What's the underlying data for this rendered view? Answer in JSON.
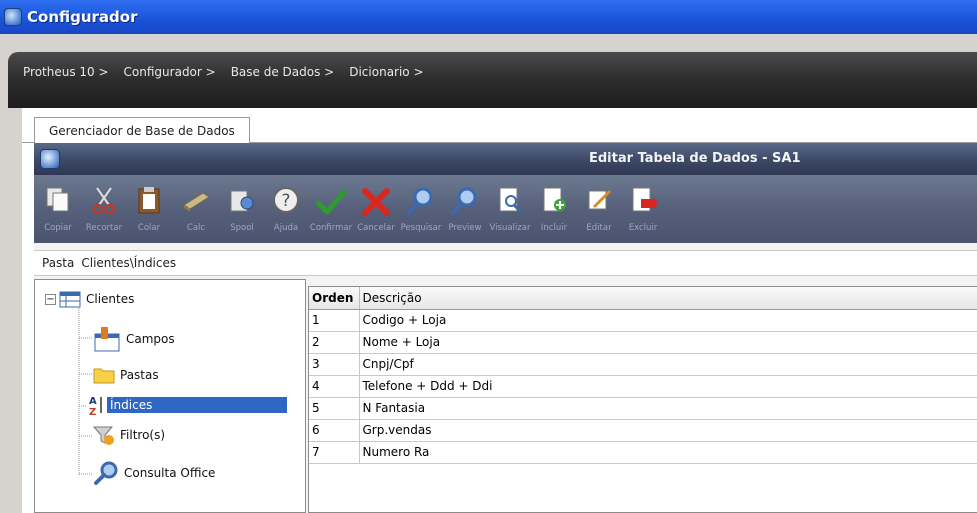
{
  "window": {
    "title": "Configurador"
  },
  "breadcrumb": [
    "Protheus 10 >",
    "Configurador >",
    "Base de Dados >",
    "Dicionario >"
  ],
  "tab": {
    "label": "Gerenciador de Base de Dados"
  },
  "editor": {
    "title": "Editar Tabela de Dados - SA1"
  },
  "toolbar": [
    {
      "label": "Copiar",
      "icon": "copy-icon"
    },
    {
      "label": "Recortar",
      "icon": "scissors-icon"
    },
    {
      "label": "Colar",
      "icon": "paste-icon"
    },
    {
      "label": "Calc",
      "icon": "calculator-icon"
    },
    {
      "label": "Spool",
      "icon": "print-spool-icon"
    },
    {
      "label": "Ajuda",
      "icon": "help-icon"
    },
    {
      "label": "Confirmar",
      "icon": "checkmark-icon"
    },
    {
      "label": "Cancelar",
      "icon": "cancel-x-icon"
    },
    {
      "label": "Pesquisar",
      "icon": "search-icon"
    },
    {
      "label": "Preview",
      "icon": "preview-magnifier-icon"
    },
    {
      "label": "Visualizar",
      "icon": "view-document-icon"
    },
    {
      "label": "Incluir",
      "icon": "add-document-icon"
    },
    {
      "label": "Editar",
      "icon": "edit-pencil-icon"
    },
    {
      "label": "Excluir",
      "icon": "delete-document-icon"
    }
  ],
  "pasta": {
    "label": "Pasta",
    "path": "Clientes\\Índices"
  },
  "tree": {
    "root": "Clientes",
    "items": [
      "Campos",
      "Pastas",
      "Índices",
      "Filtro(s)",
      "Consulta Office"
    ],
    "selected": "Índices"
  },
  "grid": {
    "columns": [
      "Orden",
      "Descrição"
    ],
    "rows": [
      [
        "1",
        "Codigo + Loja"
      ],
      [
        "2",
        "Nome + Loja"
      ],
      [
        "3",
        "Cnpj/Cpf"
      ],
      [
        "4",
        "Telefone + Ddd + Ddi"
      ],
      [
        "5",
        "N Fantasia"
      ],
      [
        "6",
        "Grp.vendas"
      ],
      [
        "7",
        "Numero Ra"
      ]
    ]
  },
  "colors": {
    "titlebar": "#1a52d9",
    "selection": "#3167c4",
    "toolbar": "#56607a",
    "check": "#2e9b2e",
    "cancel": "#d8271f"
  }
}
